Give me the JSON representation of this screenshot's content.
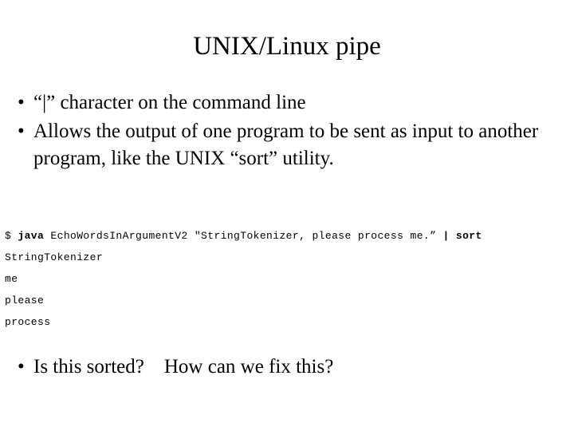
{
  "slide": {
    "title": "UNIX/Linux pipe",
    "background_color": "#ffffff",
    "text_color": "#000000"
  },
  "bullets_top": [
    {
      "marker": "•",
      "text": "“|” character on the command line"
    },
    {
      "marker": "•",
      "text": "Allows the output of one program to be sent as input to another program, like the UNIX “sort” utility."
    }
  ],
  "terminal": {
    "lines": [
      {
        "segments": [
          {
            "text": "$ ",
            "bold": false
          },
          {
            "text": "java",
            "bold": true
          },
          {
            "text": " EchoWordsInArgumentV2 \"StringTokenizer, please process me.” ",
            "bold": false
          },
          {
            "text": "|",
            "bold": true
          },
          {
            "text": " ",
            "bold": false
          },
          {
            "text": "sort",
            "bold": true
          }
        ]
      },
      {
        "segments": [
          {
            "text": "StringTokenizer",
            "bold": false
          }
        ]
      },
      {
        "segments": [
          {
            "text": "me",
            "bold": false
          }
        ]
      },
      {
        "segments": [
          {
            "text": "please",
            "bold": false
          }
        ]
      },
      {
        "segments": [
          {
            "text": "process",
            "bold": false
          }
        ]
      }
    ]
  },
  "bullets_bottom": [
    {
      "marker": "•",
      "text": "Is this sorted?    How can we fix this?"
    }
  ]
}
